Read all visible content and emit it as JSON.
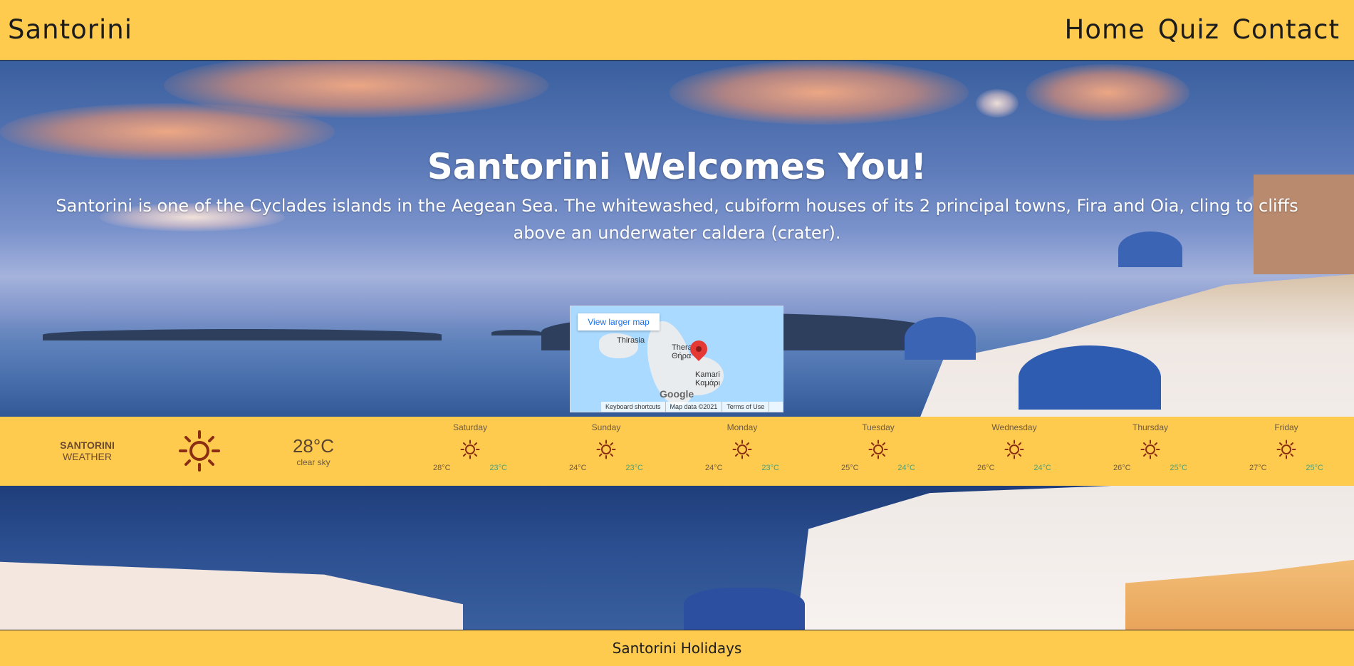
{
  "header": {
    "brand": "Santorini",
    "nav": [
      "Home",
      "Quiz",
      "Contact"
    ]
  },
  "hero": {
    "title": "Santorini Welcomes You!",
    "description": "Santorini is one of the Cyclades islands in the Aegean Sea. The whitewashed, cubiform houses of its 2 principal towns, Fira and Oia, cling to cliffs above an underwater caldera (crater)."
  },
  "map": {
    "view_larger": "View larger map",
    "labels": [
      "Thirasia",
      "Thera",
      "Θήρα",
      "Kamari",
      "Καμάρι"
    ],
    "google": "Google",
    "footer": [
      "Keyboard shortcuts",
      "Map data ©2021",
      "Terms of Use"
    ]
  },
  "weather": {
    "city": "SANTORINI",
    "subtitle": "WEATHER",
    "current_temp": "28°C",
    "current_desc": "clear sky",
    "current_icon": "sun-icon",
    "forecast": [
      {
        "day": "Saturday",
        "hi": "28°C",
        "lo": "23°C"
      },
      {
        "day": "Sunday",
        "hi": "24°C",
        "lo": "23°C"
      },
      {
        "day": "Monday",
        "hi": "24°C",
        "lo": "23°C"
      },
      {
        "day": "Tuesday",
        "hi": "25°C",
        "lo": "24°C"
      },
      {
        "day": "Wednesday",
        "hi": "26°C",
        "lo": "24°C"
      },
      {
        "day": "Thursday",
        "hi": "26°C",
        "lo": "25°C"
      },
      {
        "day": "Friday",
        "hi": "27°C",
        "lo": "25°C"
      }
    ],
    "colors": {
      "background": "#ffcb4f",
      "sun": "#8a2d12",
      "low_temp": "#4aa07a"
    }
  },
  "footer": {
    "text": "Santorini Holidays"
  }
}
